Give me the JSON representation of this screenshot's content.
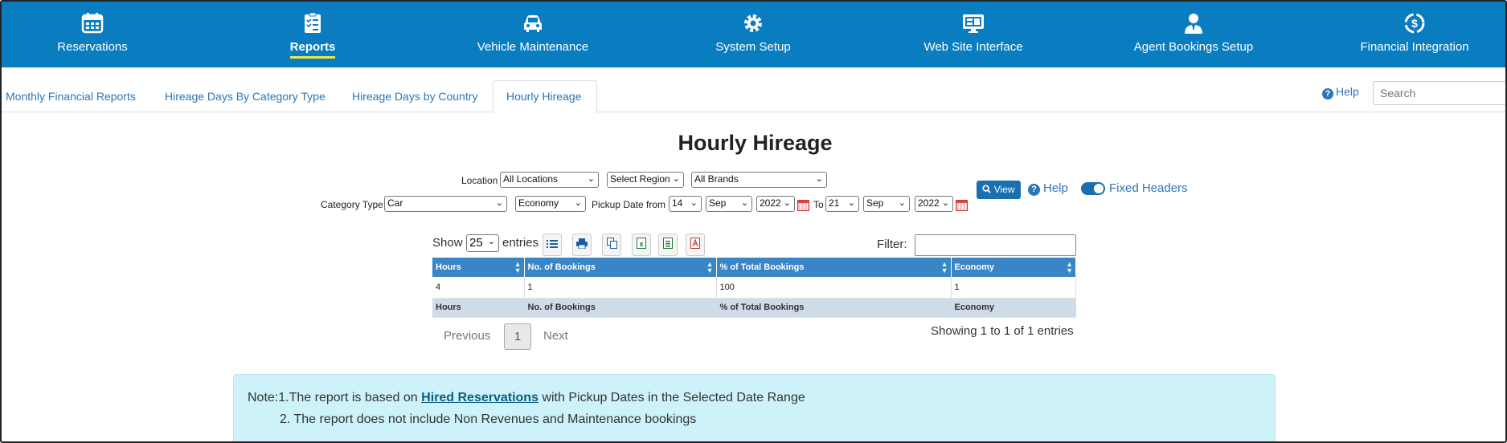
{
  "topnav": {
    "items": [
      {
        "label": "Reservations",
        "icon": "calendar-icon",
        "active": false
      },
      {
        "label": "Reports",
        "icon": "checklist-icon",
        "active": true
      },
      {
        "label": "Vehicle Maintenance",
        "icon": "car-icon",
        "active": false
      },
      {
        "label": "System Setup",
        "icon": "gear-icon",
        "active": false
      },
      {
        "label": "Web Site Interface",
        "icon": "monitor-icon",
        "active": false
      },
      {
        "label": "Agent Bookings Setup",
        "icon": "agent-icon",
        "active": false
      },
      {
        "label": "Financial Integration",
        "icon": "finance-icon",
        "active": false
      }
    ],
    "bg_color": "#0a7dc1",
    "active_underline_color": "#f5e642"
  },
  "subtabs": {
    "items": [
      {
        "label": "Monthly Financial Reports"
      },
      {
        "label": "Hireage Days By Category Type"
      },
      {
        "label": "Hireage Days by Country"
      },
      {
        "label": "Hourly Hireage",
        "active": true
      }
    ],
    "help_label": "Help",
    "search_placeholder": "Search"
  },
  "page": {
    "title": "Hourly Hireage"
  },
  "filters": {
    "location_label": "Location",
    "location_value": "All Locations",
    "region_value": "Select Region",
    "brand_value": "All Brands",
    "category_type_label": "Category Type",
    "category_type_value": "Car",
    "category_value": "Economy",
    "pickup_from_label": "Pickup Date from",
    "from_day": "14",
    "from_month": "Sep",
    "from_year": "2022",
    "to_label": "To",
    "to_day": "21",
    "to_month": "Sep",
    "to_year": "2022",
    "view_label": "View",
    "help_label": "Help",
    "fixed_headers_label": "Fixed Headers"
  },
  "table_controls": {
    "show_label": "Show",
    "page_size": "25",
    "entries_label": "entries",
    "filter_label": "Filter:"
  },
  "table": {
    "columns": [
      "Hours",
      "No. of Bookings",
      "% of Total Bookings",
      "Economy"
    ],
    "rows": [
      [
        "4",
        "1",
        "100",
        "1"
      ]
    ],
    "footer": [
      "Hours",
      "No. of Bookings",
      "% of Total Bookings",
      "Economy"
    ]
  },
  "pagination": {
    "previous_label": "Previous",
    "current_page": "1",
    "next_label": "Next",
    "summary": "Showing 1 to 1 of 1 entries"
  },
  "note": {
    "prefix": "Note:",
    "line1_start": "1.The report is based on",
    "line1_link": "Hired Reservations",
    "line1_end": "with Pickup Dates in the Selected Date Range",
    "line2": "2. The report does not include Non Revenues and Maintenance bookings"
  }
}
